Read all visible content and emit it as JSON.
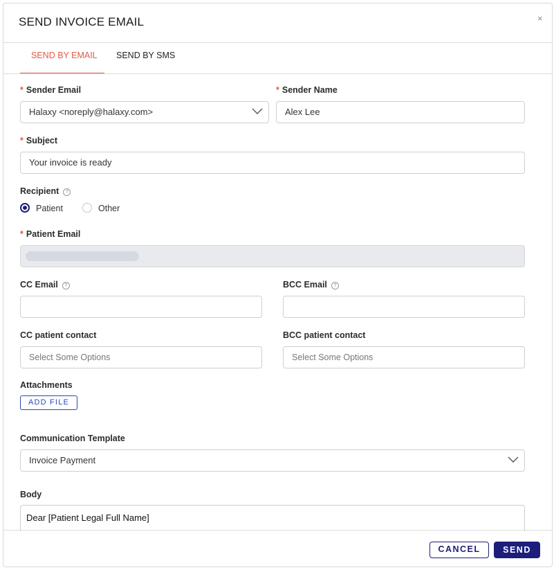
{
  "modal": {
    "title": "SEND INVOICE EMAIL",
    "close_glyph": "×"
  },
  "tabs": [
    {
      "label": "SEND BY EMAIL",
      "active": true
    },
    {
      "label": "SEND BY SMS",
      "active": false
    }
  ],
  "form": {
    "sender_email": {
      "label": "Sender Email",
      "required": true,
      "value": "Halaxy <noreply@halaxy.com>"
    },
    "sender_name": {
      "label": "Sender Name",
      "required": true,
      "value": "Alex Lee"
    },
    "subject": {
      "label": "Subject",
      "required": true,
      "value": "Your invoice is ready"
    },
    "recipient": {
      "label": "Recipient",
      "options": [
        {
          "label": "Patient",
          "selected": true
        },
        {
          "label": "Other",
          "selected": false
        }
      ]
    },
    "patient_email": {
      "label": "Patient Email",
      "required": true,
      "value": ""
    },
    "cc_email": {
      "label": "CC Email",
      "value": ""
    },
    "bcc_email": {
      "label": "BCC Email",
      "value": ""
    },
    "cc_patient_contact": {
      "label": "CC patient contact",
      "placeholder": "Select Some Options"
    },
    "bcc_patient_contact": {
      "label": "BCC patient contact",
      "placeholder": "Select Some Options"
    },
    "attachments": {
      "label": "Attachments",
      "add_button": "ADD FILE"
    },
    "communication_template": {
      "label": "Communication Template",
      "value": "Invoice Payment"
    },
    "body": {
      "label": "Body",
      "value": "Dear [Patient Legal Full Name]"
    }
  },
  "footer": {
    "cancel_label": "CANCEL",
    "send_label": "SEND"
  },
  "icons": {
    "help": "help-circle-icon",
    "chevron": "chevron-down-icon",
    "close": "close-icon"
  },
  "colors": {
    "accent": "#e25a45",
    "primary": "#1b1e7a",
    "link": "#2a45b8"
  }
}
